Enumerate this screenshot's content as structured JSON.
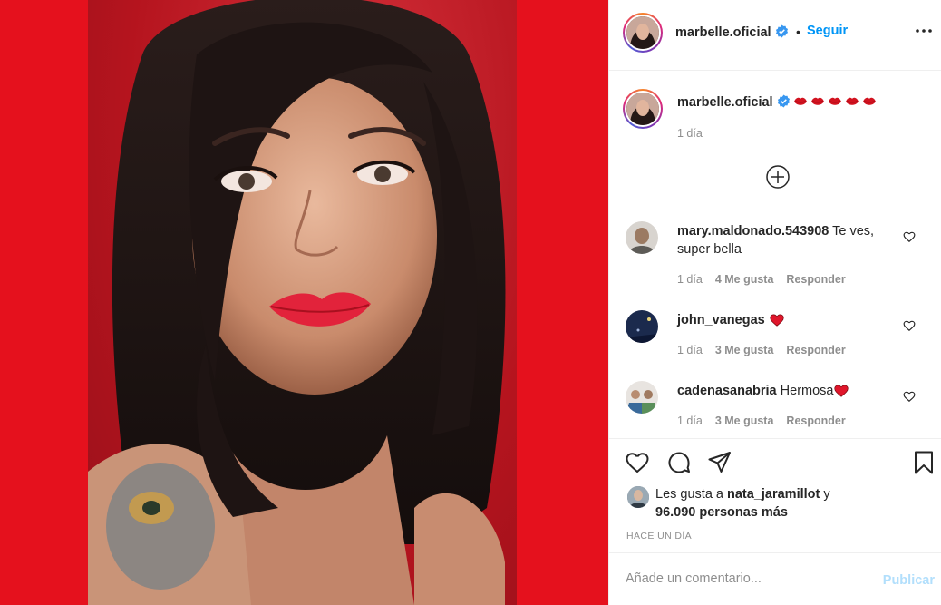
{
  "post": {
    "username": "marbelle.oficial",
    "follow_label": "Seguir",
    "dot": "•"
  },
  "caption": {
    "username": "marbelle.oficial",
    "emoji": [
      "kiss-mark",
      "kiss-mark",
      "kiss-mark",
      "kiss-mark",
      "kiss-mark"
    ],
    "time": "1 día"
  },
  "comments": [
    {
      "username": "mary.maldonado.543908",
      "text": " Te ves, super bella",
      "time": "1 día",
      "likes": "4 Me gusta",
      "reply": "Responder"
    },
    {
      "username": "john_vanegas",
      "text": " ",
      "emoji": "red-heart",
      "time": "1 día",
      "likes": "3 Me gusta",
      "reply": "Responder"
    },
    {
      "username": "cadenasanabria",
      "text": " Hermosa",
      "emoji": "red-heart",
      "time": "1 día",
      "likes": "3 Me gusta",
      "reply": "Responder"
    }
  ],
  "likes": {
    "prefix": "Les gusta a ",
    "user": "nata_jaramillot",
    "joiner": " y",
    "count": "96.090 personas más"
  },
  "timestamp": "HACE UN DÍA",
  "add_comment": {
    "placeholder": "Añade un comentario...",
    "publish_label": "Publicar"
  },
  "colors": {
    "accent": "#0095f6",
    "background_red": "#e5111d",
    "muted": "#8e8e8e",
    "publish_disabled": "#b2dffc"
  },
  "icons": {
    "more": "more-options-icon",
    "add_comments": "plus-circle-icon",
    "like": "heart-icon",
    "comment": "comment-icon",
    "share": "share-icon",
    "save": "bookmark-icon"
  }
}
